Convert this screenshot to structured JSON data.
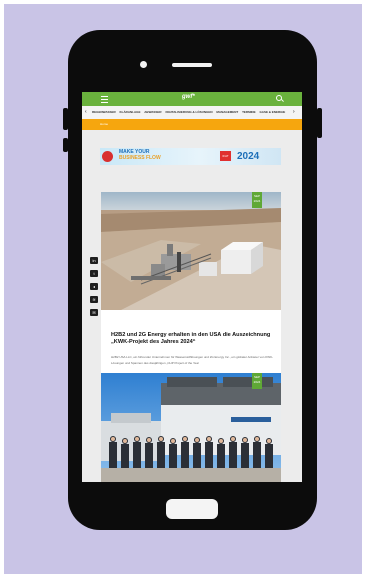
{
  "site": {
    "logo": "gwf*",
    "menu_icon": "hamburger-menu-icon",
    "search_icon": "search-icon",
    "header_color": "#6ab23d"
  },
  "nav": {
    "topics": [
      "WORLD WATER",
      "REGEN & GRUNDWASSER",
      "WASSERVERSORGUNG",
      "ABWASSER",
      "KLIMAWANDEL",
      "KOMMUNEN"
    ],
    "visible_topics": [
      "REGENWASSER",
      "KLÄRANLAGE",
      "ABWASSER",
      "DIGITALISIERUNG & LÖSUNGEN",
      "MANAGEMENT",
      "TERMINE",
      "GASE & ENERGIE"
    ]
  },
  "breadcrumb": {
    "home_label": "Home",
    "bar_color": "#f6a60e"
  },
  "ad": {
    "title_line1": "MAKE YOUR",
    "title_line2": "BUSINESS FLOW",
    "badge": "IFAT",
    "year": "2024"
  },
  "article1": {
    "date_day": "SEP",
    "date_year": "2024",
    "headline": "H2B2 und 2G Energy erhalten in den USA die Auszeichnung „KWK-Projekt des Jahres 2024“",
    "excerpt": "H2B2 USA LLC, ein führender Unternehmen für Wasserstofflösungen und 2G Energy Inc., ein globaler Anbieter von KWK-Lösungen und Spannen des diesjährigen „CHP Project of the Year"
  },
  "article2": {
    "date_day": "SEP",
    "date_year": "2024"
  },
  "share": [
    {
      "name": "linkedin-icon",
      "glyph": "in"
    },
    {
      "name": "twitter-icon",
      "glyph": "t"
    },
    {
      "name": "telegram-icon",
      "glyph": "◂"
    },
    {
      "name": "rss-icon",
      "glyph": "≋"
    },
    {
      "name": "email-icon",
      "glyph": "✉"
    }
  ]
}
